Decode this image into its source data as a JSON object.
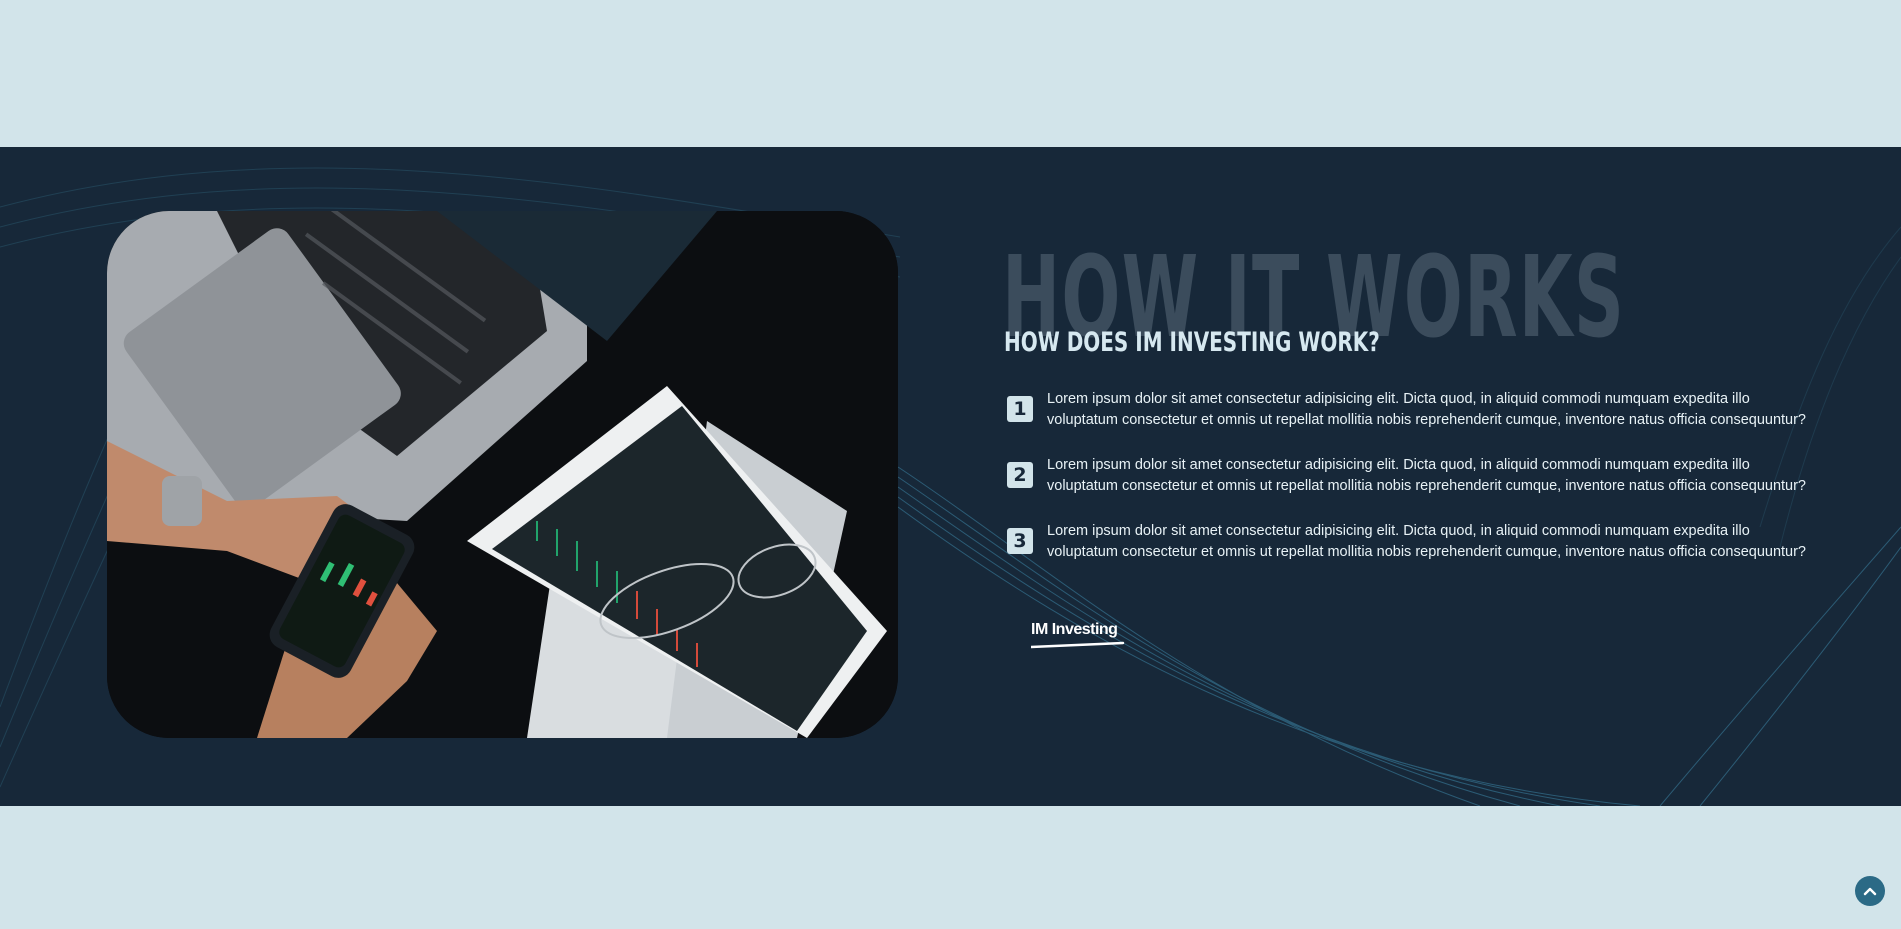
{
  "section": {
    "background_word": "HOW IT WORKS",
    "heading": "HOW DOES IM INVESTING WORK?",
    "steps": [
      {
        "number": "1",
        "text": "Lorem ipsum dolor sit amet consectetur adipisicing elit. Dicta quod, in aliquid commodi numquam expedita illo voluptatum consectetur et omnis ut repellat mollitia nobis reprehenderit cumque, inventore natus officia consequuntur?"
      },
      {
        "number": "2",
        "text": "Lorem ipsum dolor sit amet consectetur adipisicing elit. Dicta quod, in aliquid commodi numquam expedita illo voluptatum consectetur et omnis ut repellat mollitia nobis reprehenderit cumque, inventore natus officia consequuntur?"
      },
      {
        "number": "3",
        "text": "Lorem ipsum dolor sit amet consectetur adipisicing elit. Dicta quod, in aliquid commodi numquam expedita illo voluptatum consectetur et omnis ut repellat mollitia nobis reprehenderit cumque, inventore natus officia consequuntur?"
      }
    ],
    "logo_text": "IM Investing"
  },
  "scroll_top": {
    "icon": "chevron-up-icon"
  },
  "colors": {
    "page_background": "#d2e4ea",
    "section_background": "#172839",
    "background_word": "#3b4c5c",
    "accent": "#2b6a86"
  }
}
